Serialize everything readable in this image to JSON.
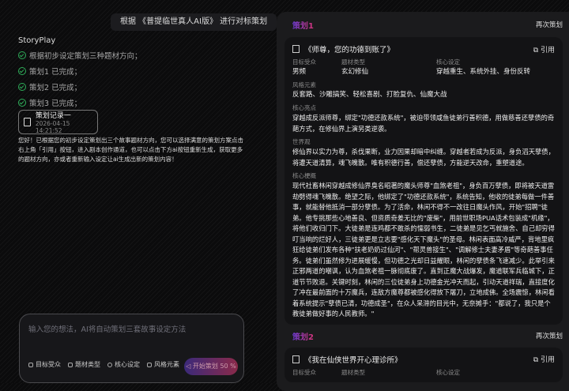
{
  "chat": {
    "user_message": "根据 《普提临世真人AI版》 进行对标策划",
    "brand": "StoryPlay",
    "steps": [
      "根据初步设定策划三种题材方向；",
      "策划1 已完成；",
      "策划2 已完成；",
      "策划3 已完成；"
    ],
    "record": {
      "title": "策划记录一",
      "time": "2026-04-15 14:21:52"
    },
    "reply": "您好！已根据您的初步设定策划出三个故事题材方向，您可以选择满意的策划方案点击右上角「引用」按钮，进入剧本创作通道，也可以点击下方ai按钮重新生成，获取更多的题材方向，亦或者重新输入设定让ai生成出新的策划内容！"
  },
  "input": {
    "placeholder": "输入您的想法，AI将自动策划三套故事设定方法",
    "tags": [
      "目标受众",
      "题材类型",
      "核心设定",
      "风格元素"
    ],
    "submit": "开始策划 50 %"
  },
  "plans": [
    {
      "label": "策划1",
      "again": "再次策划",
      "title": "《师尊，您的功德到账了》",
      "cite": "引用",
      "audience_label": "目标受众",
      "audience": "男频",
      "genre_label": "题材类型",
      "genre": "玄幻修仙",
      "core_label": "核心设定",
      "core": "穿越重生、系统外挂、身份反转",
      "style_label": "风格元素",
      "style": "反套路、沙雕搞笑、轻松喜剧、打脸复仇、仙魔大战",
      "highlight_label": "核心亮点",
      "highlight": "穿越成反派师尊，绑定\"功德还款系统\"，被迫带领咸鱼徒弟行善积德，用做慈善还孽债的奇葩方式，在修仙界上演另类逆袭。",
      "world_label": "世界观",
      "world": "修仙界以实力为尊，杀伐果断，业力因果却暗中纠缠。穿越者若成为反派，身负滔天孽债，将遭天道清算，魂飞魄散。唯有积德行善，偿还孽债，方能逆天改命，重塑道途。",
      "plot_label": "核心梗概",
      "plot": "现代社畜林闲穿越成修仙界臭名昭著的魔头师尊\"血煞老祖\"，身负百万孽债，即将被天道雷劫劈得魂飞魄散。绝望之际，他绑定了\"功德还款系统\"，系统告知，他收的徒弟每做一件善事，就能替他抵消一部分孽债。为了活命，林闲不得不一改往日魔头作风，开始\"招聘\"徒弟。他专挑那些心地善良、但资质奇差无比的\"废柴\"，用前世职场PUA话术包装成\"机缘\"，将他们收归门下。大徒弟是连鸡都不敢杀的懦弱书生，二徒弟是见乞丐就施舍、自己却穷得叮当响的烂好人，三徒弟更是立志要\"感化天下魔头\"的圣母。林闲表面高冷威严，背地里疯狂给徒弟们发布各种\"扶老奶奶过仙河\"、\"帮灵兽接生\"、\"调解修士夫妻矛盾\"等奇葩善事任务。徒弟们虽然修为进展缓慢，但功德之光却日益耀眼，林闲的孽债条飞速减少。此举引来正邪两道的嘲讽，认为血煞老祖一脉彻底废了。直到正魔大战爆发，魔道联军兵临城下，正道节节败退。关键时刻，林闲的三位徒弟身上功德金光冲天而起，引动天道祥瑞，直接度化了冲在最前面的十万魔兵，连敌方魔尊都被感化得放下屠刀，立地成佛。全场震惊，林闲看着系统提示\"孽债已清，功德成圣\"，在众人呆滞的目光中，无奈摊手：\"都说了，我只是个教徒弟做好事的人民教师。\""
    },
    {
      "label": "策划2",
      "again": "再次策划",
      "title": "《我在仙侠世界开心理诊所》",
      "cite": "引用",
      "audience_label": "目标受众",
      "genre_label": "题材类型",
      "core_label": "核心设定"
    }
  ]
}
